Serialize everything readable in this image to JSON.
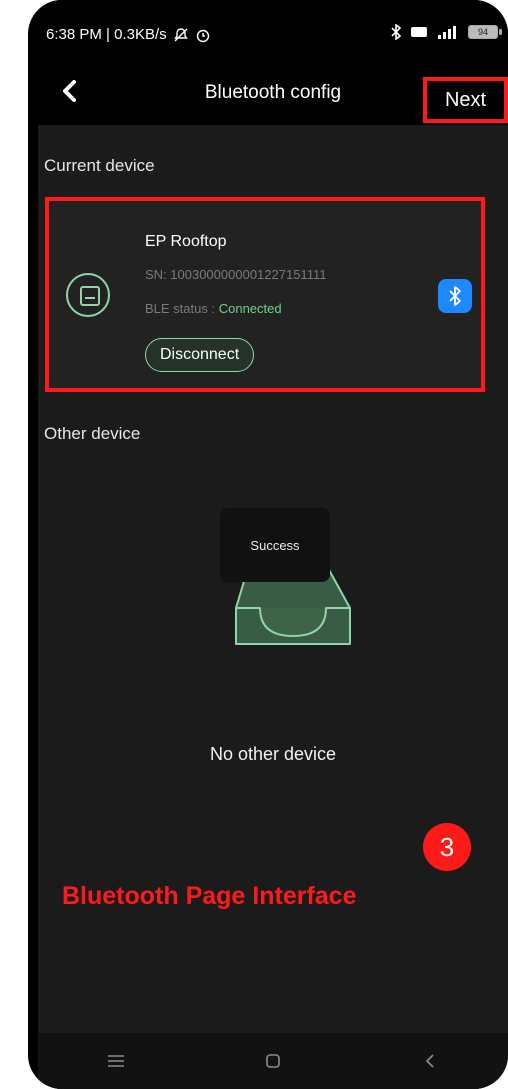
{
  "status_bar": {
    "time_speed": "6:38 PM | 0.3KB/s",
    "battery": "94"
  },
  "header": {
    "back_icon": "chevron-left-icon",
    "title": "Bluetooth config",
    "next_label": "Next"
  },
  "current_section": {
    "label": "Current device",
    "device": {
      "name": "EP Rooftop",
      "sn": "SN: 1003000000001227151111",
      "ble_label": "BLE status :",
      "ble_value": "Connected",
      "disconnect_label": "Disconnect",
      "icon": "device-icon",
      "badge_icon": "bluetooth-icon"
    }
  },
  "other_section": {
    "label": "Other device",
    "toast": "Success",
    "empty_text": "No other device"
  },
  "annotation": {
    "step_number": "3",
    "caption": "Bluetooth Page Interface"
  },
  "colors": {
    "accent_green": "#8ed6a6",
    "connected_green": "#6fd389",
    "highlight_red": "#ff1a1a",
    "bluetooth_blue": "#1e88ff"
  }
}
